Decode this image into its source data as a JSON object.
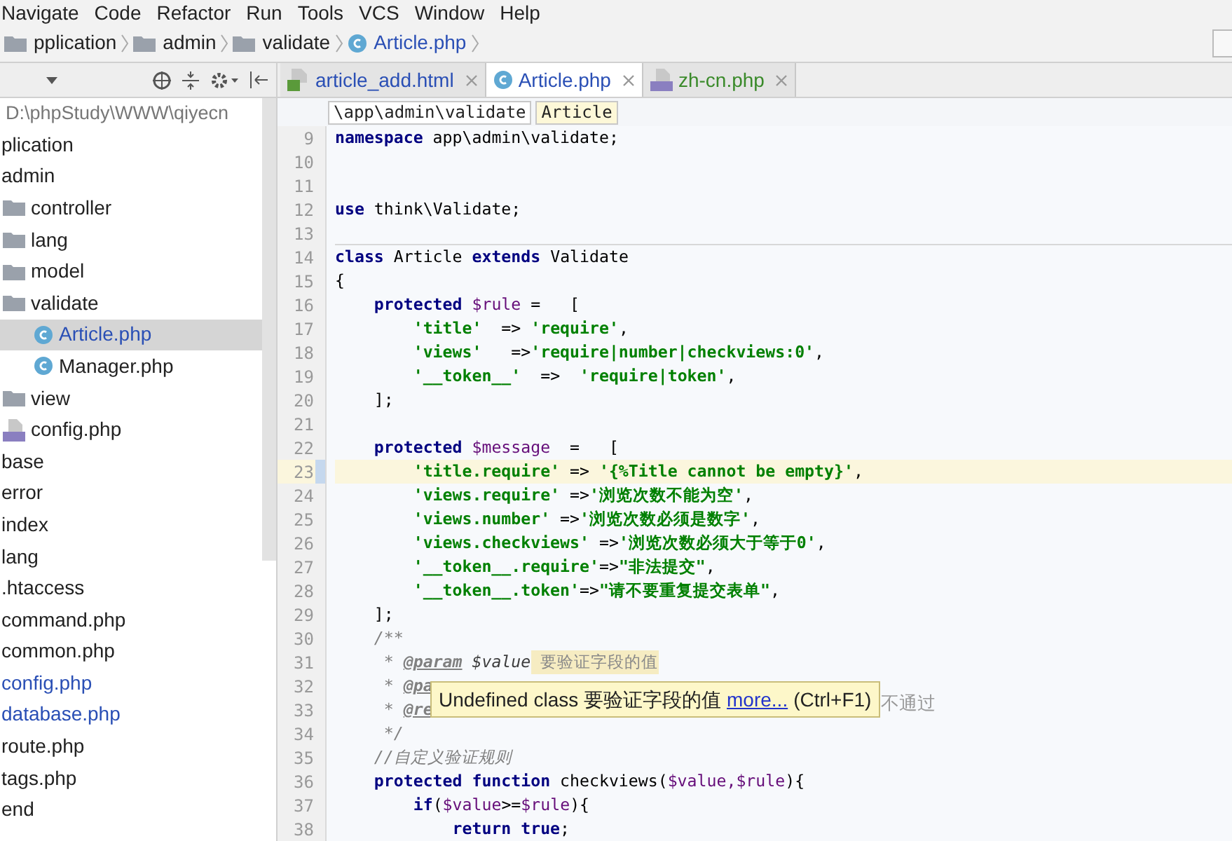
{
  "menu": [
    "Navigate",
    "Code",
    "Refactor",
    "Run",
    "Tools",
    "VCS",
    "Window",
    "Help"
  ],
  "breadcrumb": [
    {
      "kind": "folder",
      "label": "pplication"
    },
    {
      "kind": "folder",
      "label": "admin"
    },
    {
      "kind": "folder",
      "label": "validate"
    },
    {
      "kind": "class",
      "label": "Article.php"
    }
  ],
  "project": {
    "path": "D:\\phpStudy\\WWW\\qiyecn",
    "items": [
      {
        "label": "plication",
        "selected": false,
        "modified": false
      },
      {
        "label": "admin",
        "selected": false,
        "modified": false,
        "children": [
          {
            "kind": "folder",
            "label": "controller",
            "selected": false,
            "modified": false
          },
          {
            "kind": "folder",
            "label": "lang",
            "selected": false,
            "modified": false
          },
          {
            "kind": "folder",
            "label": "model",
            "selected": false,
            "modified": false
          },
          {
            "kind": "folder",
            "label": "validate",
            "selected": false,
            "modified": false,
            "children": [
              {
                "kind": "class",
                "label": "Article.php",
                "selected": true,
                "modified": false
              },
              {
                "kind": "class",
                "label": "Manager.php",
                "selected": false,
                "modified": false
              }
            ]
          },
          {
            "kind": "folder",
            "label": "view",
            "selected": false,
            "modified": false
          },
          {
            "kind": "php",
            "label": "config.php",
            "selected": false,
            "modified": false
          }
        ]
      },
      {
        "label": "base",
        "selected": false,
        "modified": false
      },
      {
        "label": "error",
        "selected": false,
        "modified": false
      },
      {
        "label": "index",
        "selected": false,
        "modified": false
      },
      {
        "label": "lang",
        "selected": false,
        "modified": false
      },
      {
        "label": ".htaccess",
        "selected": false,
        "modified": false
      },
      {
        "label": "command.php",
        "selected": false,
        "modified": false
      },
      {
        "label": "common.php",
        "selected": false,
        "modified": false
      },
      {
        "label": "config.php",
        "selected": false,
        "modified": true
      },
      {
        "label": "database.php",
        "selected": false,
        "modified": true
      },
      {
        "label": "route.php",
        "selected": false,
        "modified": false
      },
      {
        "label": "tags.php",
        "selected": false,
        "modified": false
      },
      {
        "label": "end",
        "selected": false,
        "modified": false
      }
    ]
  },
  "tabs": [
    {
      "kind": "html",
      "label": "article_add.html",
      "selected": false,
      "modified": false
    },
    {
      "kind": "class",
      "label": "Article.php",
      "selected": true,
      "modified": false
    },
    {
      "kind": "php",
      "label": "zh-cn.php",
      "selected": false,
      "modified": true
    }
  ],
  "editor_breadcrumb": [
    "\\app\\admin\\validate",
    "Article"
  ],
  "code": [
    {
      "number": "9",
      "current": false,
      "tokens": [
        {
          "kind": "kw",
          "text": "namespace"
        },
        {
          "kind": "plain",
          "text": " app\\admin\\validate;"
        }
      ]
    },
    {
      "number": "10",
      "current": false
    },
    {
      "number": "11",
      "current": false
    },
    {
      "number": "12",
      "current": false,
      "tokens": [
        {
          "kind": "kw",
          "text": "use"
        },
        {
          "kind": "plain",
          "text": " think\\Validate;"
        }
      ]
    },
    {
      "number": "13",
      "current": false
    },
    {
      "number": "14",
      "current": false,
      "tokens": [
        {
          "kind": "kw",
          "text": "class"
        },
        {
          "kind": "plain",
          "text": " Article "
        },
        {
          "kind": "kw",
          "text": "extends"
        },
        {
          "kind": "plain",
          "text": " Validate"
        }
      ]
    },
    {
      "number": "15",
      "current": false,
      "tokens": [
        {
          "kind": "plain",
          "text": "{"
        }
      ]
    },
    {
      "number": "16",
      "current": false,
      "tokens": [
        {
          "kind": "kw",
          "text": "    protected"
        },
        {
          "kind": "var",
          "text": " $rule"
        },
        {
          "kind": "plain",
          "text": " =   ["
        }
      ]
    },
    {
      "number": "17",
      "current": false,
      "tokens": [
        {
          "kind": "str",
          "text": "        'title'"
        },
        {
          "kind": "plain",
          "text": "  => "
        },
        {
          "kind": "str",
          "text": "'require'"
        },
        {
          "kind": "plain",
          "text": ","
        }
      ]
    },
    {
      "number": "18",
      "current": false,
      "tokens": [
        {
          "kind": "str",
          "text": "        'views'"
        },
        {
          "kind": "plain",
          "text": "   =>"
        },
        {
          "kind": "str",
          "text": "'require|number|checkviews:0'"
        },
        {
          "kind": "plain",
          "text": ","
        }
      ]
    },
    {
      "number": "19",
      "current": false,
      "tokens": [
        {
          "kind": "str",
          "text": "        '__token__'"
        },
        {
          "kind": "plain",
          "text": "  =>  "
        },
        {
          "kind": "str",
          "text": "'require|token'"
        },
        {
          "kind": "plain",
          "text": ","
        }
      ]
    },
    {
      "number": "20",
      "current": false,
      "tokens": [
        {
          "kind": "plain",
          "text": "    ];"
        }
      ]
    },
    {
      "number": "21",
      "current": false
    },
    {
      "number": "22",
      "current": false,
      "tokens": [
        {
          "kind": "kw",
          "text": "    protected"
        },
        {
          "kind": "var",
          "text": " $message"
        },
        {
          "kind": "plain",
          "text": "  =   ["
        }
      ]
    },
    {
      "number": "23",
      "current": true,
      "tokens": [
        {
          "kind": "str",
          "text": "        'title.require'"
        },
        {
          "kind": "plain",
          "text": " => "
        },
        {
          "kind": "str",
          "text": "'{%Title cannot be empty}'"
        },
        {
          "kind": "plain",
          "text": ","
        }
      ]
    },
    {
      "number": "24",
      "current": false,
      "tokens": [
        {
          "kind": "str",
          "text": "        'views.require'"
        },
        {
          "kind": "plain",
          "text": " =>"
        },
        {
          "kind": "str",
          "text": "'浏览次数不能为空'"
        },
        {
          "kind": "plain",
          "text": ","
        }
      ]
    },
    {
      "number": "25",
      "current": false,
      "tokens": [
        {
          "kind": "str",
          "text": "        'views.number'"
        },
        {
          "kind": "plain",
          "text": " =>"
        },
        {
          "kind": "str",
          "text": "'浏览次数必须是数字'"
        },
        {
          "kind": "plain",
          "text": ","
        }
      ]
    },
    {
      "number": "26",
      "current": false,
      "tokens": [
        {
          "kind": "str",
          "text": "        'views.checkviews'"
        },
        {
          "kind": "plain",
          "text": " =>"
        },
        {
          "kind": "str",
          "text": "'浏览次数必须大于等于0'"
        },
        {
          "kind": "plain",
          "text": ","
        }
      ]
    },
    {
      "number": "27",
      "current": false,
      "tokens": [
        {
          "kind": "str",
          "text": "        '__token__.require'"
        },
        {
          "kind": "plain",
          "text": "=>"
        },
        {
          "kind": "str",
          "text": "\"非法提交\""
        },
        {
          "kind": "plain",
          "text": ","
        }
      ]
    },
    {
      "number": "28",
      "current": false,
      "tokens": [
        {
          "kind": "str",
          "text": "        '__token__.token'"
        },
        {
          "kind": "plain",
          "text": "=>"
        },
        {
          "kind": "str",
          "text": "\"请不要重复提交表单\""
        },
        {
          "kind": "plain",
          "text": ","
        }
      ]
    },
    {
      "number": "29",
      "current": false,
      "tokens": [
        {
          "kind": "plain",
          "text": "    ];"
        }
      ]
    },
    {
      "number": "30",
      "current": false,
      "tokens": [
        {
          "kind": "comment",
          "text": "    /**"
        }
      ]
    },
    {
      "number": "31",
      "current": false,
      "tokens": [
        {
          "kind": "comment",
          "text": "     * "
        },
        {
          "kind": "doctag",
          "text": "@param"
        },
        {
          "kind": "docvar",
          "text": " $value"
        },
        {
          "kind": "highlight",
          "text": " 要验证字段的值"
        }
      ]
    },
    {
      "number": "32",
      "current": false,
      "tokens": [
        {
          "kind": "comment",
          "text": "     * "
        },
        {
          "kind": "doctag",
          "text": "@pa"
        }
      ]
    },
    {
      "number": "33",
      "current": false,
      "tokens": [
        {
          "kind": "comment",
          "text": "     * "
        },
        {
          "kind": "doctag",
          "text": "@re"
        }
      ]
    },
    {
      "number": "34",
      "current": false,
      "tokens": [
        {
          "kind": "comment",
          "text": "     */"
        }
      ]
    },
    {
      "number": "35",
      "current": false,
      "tokens": [
        {
          "kind": "comment",
          "text": "    //自定义验证规则"
        }
      ]
    },
    {
      "number": "36",
      "current": false,
      "tokens": [
        {
          "kind": "kw",
          "text": "    protected function"
        },
        {
          "kind": "plain",
          "text": " checkviews("
        },
        {
          "kind": "var",
          "text": "$value,$rule"
        },
        {
          "kind": "plain",
          "text": "){"
        }
      ]
    },
    {
      "number": "37",
      "current": false,
      "tokens": [
        {
          "kind": "kw",
          "text": "        if"
        },
        {
          "kind": "plain",
          "text": "("
        },
        {
          "kind": "var",
          "text": "$value"
        },
        {
          "kind": "plain",
          "text": ">="
        },
        {
          "kind": "var",
          "text": "$rule"
        },
        {
          "kind": "plain",
          "text": "){"
        }
      ]
    },
    {
      "number": "38",
      "current": false,
      "tokens": [
        {
          "kind": "kw",
          "text": "            return true"
        },
        {
          "kind": "plain",
          "text": ";"
        }
      ]
    }
  ],
  "tooltip": {
    "text": "Undefined class 要验证字段的值",
    "link": "more...",
    "shortcut": "(Ctrl+F1)",
    "tail": "不通过"
  }
}
